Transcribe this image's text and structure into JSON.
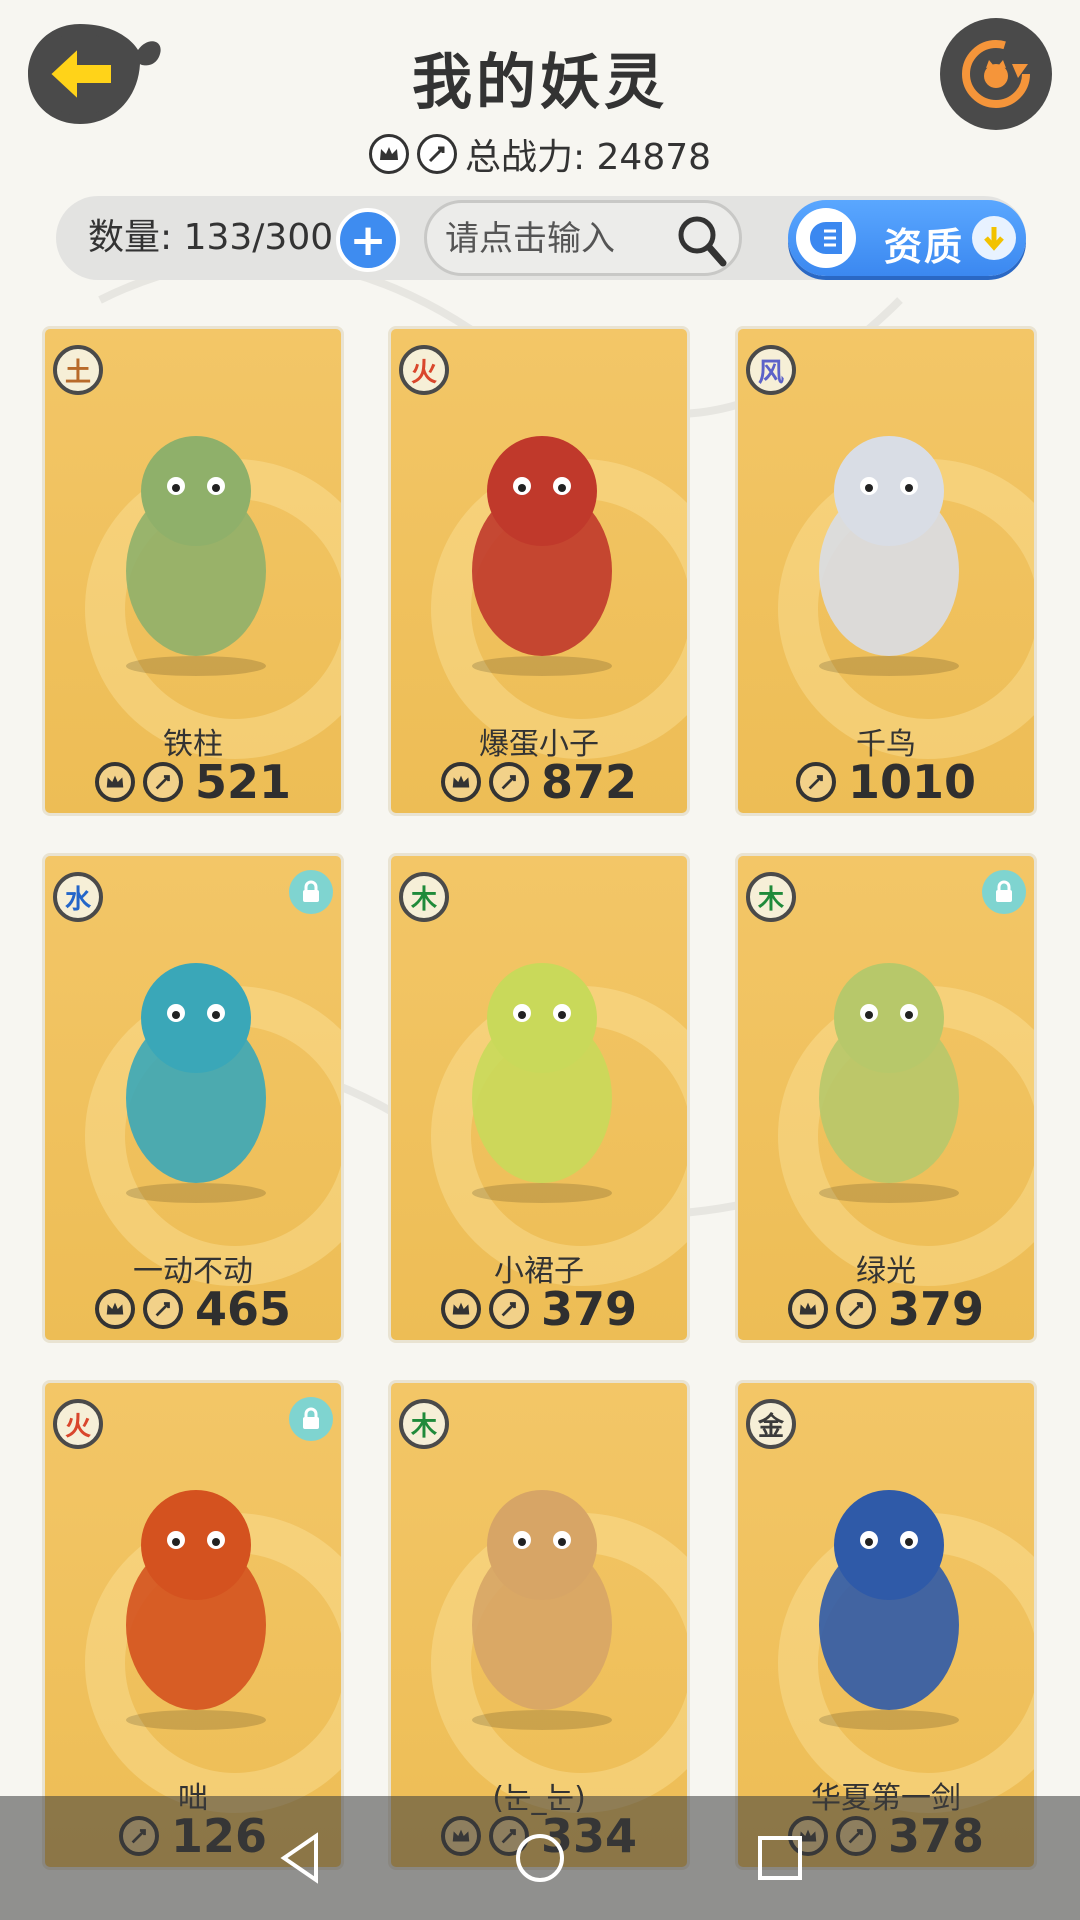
{
  "header": {
    "title": "我的妖灵",
    "total_power_label": "总战力: 24878"
  },
  "toolbar": {
    "count_label": "数量: 133/300",
    "search_placeholder": "请点击输入",
    "quality_label": "资质"
  },
  "element_colors": {
    "土": "#b86a2a",
    "火": "#d9462c",
    "风": "#5c62c9",
    "水": "#2466c9",
    "木": "#1f8a3a",
    "金": "#3b3b3b"
  },
  "cards": [
    {
      "name": "铁柱",
      "element": "土",
      "power": "521",
      "locked": false,
      "crown": true
    },
    {
      "name": "爆蛋小子",
      "element": "火",
      "power": "872",
      "locked": false,
      "crown": true
    },
    {
      "name": "千鸟",
      "element": "风",
      "power": "1010",
      "locked": false,
      "crown": false
    },
    {
      "name": "一动不动",
      "element": "水",
      "power": "465",
      "locked": true,
      "crown": true
    },
    {
      "name": "小裙子",
      "element": "木",
      "power": "379",
      "locked": false,
      "crown": true
    },
    {
      "name": "绿光",
      "element": "木",
      "power": "379",
      "locked": true,
      "crown": true
    },
    {
      "name": "咄",
      "element": "火",
      "power": "126",
      "locked": true,
      "crown": false
    },
    {
      "name": "(눈_눈)",
      "element": "木",
      "power": "334",
      "locked": false,
      "crown": true
    },
    {
      "name": "华夏第一剑",
      "element": "金",
      "power": "378",
      "locked": false,
      "crown": true
    }
  ]
}
